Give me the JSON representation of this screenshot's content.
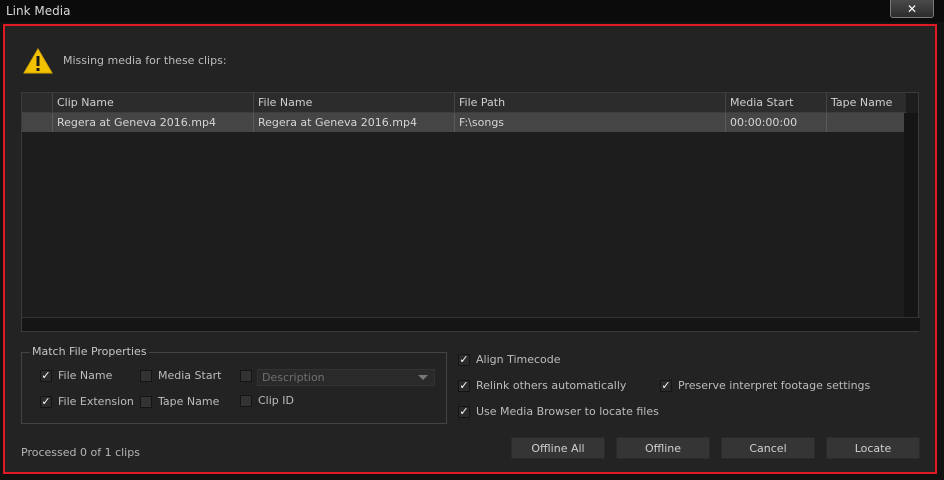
{
  "window": {
    "title": "Link Media",
    "close_label": "✕"
  },
  "message": "Missing media for these clips:",
  "table": {
    "columns": [
      "Clip Name",
      "File Name",
      "File Path",
      "Media Start",
      "Tape Name"
    ],
    "rows": [
      [
        "Regera at Geneva 2016.mp4",
        "Regera at Geneva 2016.mp4",
        "F:\\songs",
        "00:00:00:00",
        ""
      ]
    ]
  },
  "match": {
    "legend": "Match File Properties",
    "file_name": {
      "label": "File Name",
      "checked": true
    },
    "media_start": {
      "label": "Media Start",
      "checked": false
    },
    "description": {
      "label": "Description",
      "checked": false
    },
    "file_extension": {
      "label": "File Extension",
      "checked": true
    },
    "tape_name": {
      "label": "Tape Name",
      "checked": false
    },
    "clip_id": {
      "label": "Clip ID",
      "checked": false
    }
  },
  "options": {
    "align_timecode": {
      "label": "Align Timecode",
      "checked": true
    },
    "relink_others": {
      "label": "Relink others automatically",
      "checked": true
    },
    "preserve_interpret": {
      "label": "Preserve interpret footage settings",
      "checked": true
    },
    "use_media_browser": {
      "label": "Use Media Browser to locate files",
      "checked": true
    }
  },
  "status": "Processed 0 of 1 clips",
  "buttons": {
    "offline_all": "Offline All",
    "offline": "Offline",
    "cancel": "Cancel",
    "locate": "Locate"
  },
  "check_glyph": "✓",
  "colors": {
    "accent_border": "#e01a24",
    "warning_icon": "#f2c200",
    "selected_row": "#454545"
  }
}
